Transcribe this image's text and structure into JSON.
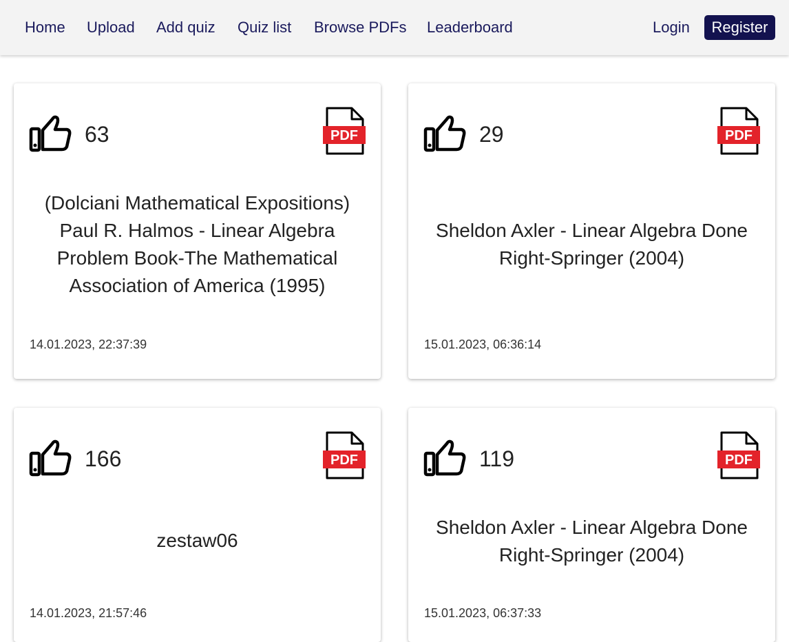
{
  "nav": {
    "links": [
      {
        "label": "Home"
      },
      {
        "label": "Upload"
      },
      {
        "label": "Add quiz"
      },
      {
        "label": "Quiz list"
      },
      {
        "label": "Browse PDFs"
      },
      {
        "label": "Leaderboard"
      }
    ],
    "login_label": "Login",
    "register_label": "Register"
  },
  "colors": {
    "nav_background": "#f3f3f3",
    "nav_link": "#1a1a5c",
    "register_button": "#13124f",
    "pdf_red": "#e3232a"
  },
  "cards": [
    {
      "likes": "63",
      "title": "(Dolciani Mathematical Expositions) Paul R. Halmos - Linear Algebra Problem Book-The Mathematical Association of America (1995)",
      "date": "14.01.2023, 22:37:39",
      "like_icon": "thumbs-up-icon",
      "file_icon": "pdf-icon",
      "file_icon_text": "PDF"
    },
    {
      "likes": "29",
      "title": "Sheldon Axler - Linear Algebra Done Right-Springer (2004)",
      "date": "15.01.2023, 06:36:14",
      "like_icon": "thumbs-up-icon",
      "file_icon": "pdf-icon",
      "file_icon_text": "PDF"
    },
    {
      "likes": "166",
      "title": "zestaw06",
      "date": "14.01.2023, 21:57:46",
      "like_icon": "thumbs-up-icon",
      "file_icon": "pdf-icon",
      "file_icon_text": "PDF"
    },
    {
      "likes": "119",
      "title": "Sheldon Axler - Linear Algebra Done Right-Springer (2004)",
      "date": "15.01.2023, 06:37:33",
      "like_icon": "thumbs-up-icon",
      "file_icon": "pdf-icon",
      "file_icon_text": "PDF"
    }
  ]
}
